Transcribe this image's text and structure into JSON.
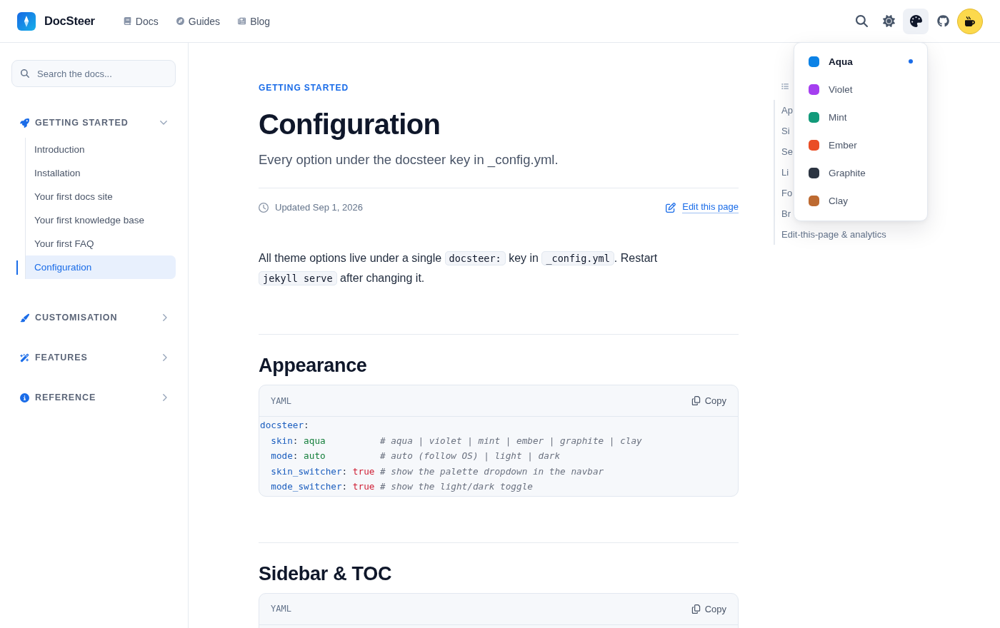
{
  "navbar": {
    "brand": "DocSteer",
    "links": [
      {
        "label": "Docs",
        "kind": "book"
      },
      {
        "label": "Guides",
        "kind": "compass"
      },
      {
        "label": "Blog",
        "kind": "newspaper"
      }
    ]
  },
  "skin_menu": {
    "open": true,
    "items": [
      {
        "label": "Aqua",
        "color": "#0c82e6",
        "selected": true
      },
      {
        "label": "Violet",
        "color": "#a53ff0",
        "selected": false
      },
      {
        "label": "Mint",
        "color": "#129a7a",
        "selected": false
      },
      {
        "label": "Ember",
        "color": "#ea4d25",
        "selected": false
      },
      {
        "label": "Graphite",
        "color": "#2b3441",
        "selected": false
      },
      {
        "label": "Clay",
        "color": "#bd6a31",
        "selected": false
      }
    ]
  },
  "sidebar": {
    "search": {
      "placeholder": "Search the docs..."
    },
    "sections": [
      {
        "title": "GETTING STARTED",
        "kind": "rocket",
        "expanded": true,
        "children": [
          {
            "label": "Introduction",
            "selected": false
          },
          {
            "label": "Installation",
            "selected": false
          },
          {
            "label": "Your first docs site",
            "selected": false
          },
          {
            "label": "Your first knowledge base",
            "selected": false
          },
          {
            "label": "Your first FAQ",
            "selected": false
          },
          {
            "label": "Configuration",
            "selected": true
          }
        ]
      },
      {
        "title": "CUSTOMISATION",
        "kind": "brush",
        "expanded": false
      },
      {
        "title": "FEATURES",
        "kind": "wand",
        "expanded": false
      },
      {
        "title": "REFERENCE",
        "kind": "info",
        "expanded": false
      }
    ]
  },
  "doc": {
    "eyebrow": "GETTING STARTED",
    "title": "Configuration",
    "subtitle": "Every option under the docsteer key in _config.yml.",
    "meta": {
      "updated": "Updated Sep 1, 2026",
      "edit_label": "Edit this page"
    },
    "intro": [
      {
        "kind": "text",
        "text": "All theme options live under a single "
      },
      {
        "kind": "code",
        "text": "docsteer:"
      },
      {
        "kind": "text",
        "text": " key in "
      },
      {
        "kind": "code",
        "text": "_config.yml"
      },
      {
        "kind": "text",
        "text": ". Restart "
      },
      {
        "kind": "code",
        "text": "jekyll serve"
      },
      {
        "kind": "text",
        "text": " after changing it."
      }
    ],
    "sections": [
      {
        "heading": "Appearance",
        "code": {
          "language": "YAML",
          "copy_label": "Copy",
          "lines": [
            {
              "tokens": [
                {
                  "kind": "key",
                  "text": "docsteer"
                },
                {
                  "kind": "plain",
                  "text": ":"
                }
              ],
              "children": [
                {
                  "tokens": [
                    {
                      "kind": "key",
                      "text": "skin"
                    },
                    {
                      "kind": "plain",
                      "text": ": "
                    },
                    {
                      "kind": "string",
                      "text": "aqua"
                    }
                  ],
                  "comment": "# aqua | violet | mint | ember | graphite | clay"
                },
                {
                  "tokens": [
                    {
                      "kind": "key",
                      "text": "mode"
                    },
                    {
                      "kind": "plain",
                      "text": ": "
                    },
                    {
                      "kind": "string",
                      "text": "auto"
                    }
                  ],
                  "comment": "# auto (follow OS) | light | dark"
                },
                {
                  "tokens": [
                    {
                      "kind": "key",
                      "text": "skin_switcher"
                    },
                    {
                      "kind": "plain",
                      "text": ": "
                    },
                    {
                      "kind": "bool",
                      "text": "true"
                    }
                  ],
                  "comment": "# show the palette dropdown in the navbar"
                },
                {
                  "tokens": [
                    {
                      "kind": "key",
                      "text": "mode_switcher"
                    },
                    {
                      "kind": "plain",
                      "text": ": "
                    },
                    {
                      "kind": "bool",
                      "text": "true"
                    }
                  ],
                  "comment": "# show the light/dark toggle"
                }
              ]
            }
          ]
        }
      },
      {
        "heading": "Sidebar & TOC",
        "code": {
          "language": "YAML",
          "copy_label": "Copy"
        }
      }
    ]
  },
  "toc": {
    "items": [
      "Ap",
      "Si",
      "Se",
      "Li",
      "Fo",
      "Br",
      "Edit-this-page & analytics"
    ]
  }
}
